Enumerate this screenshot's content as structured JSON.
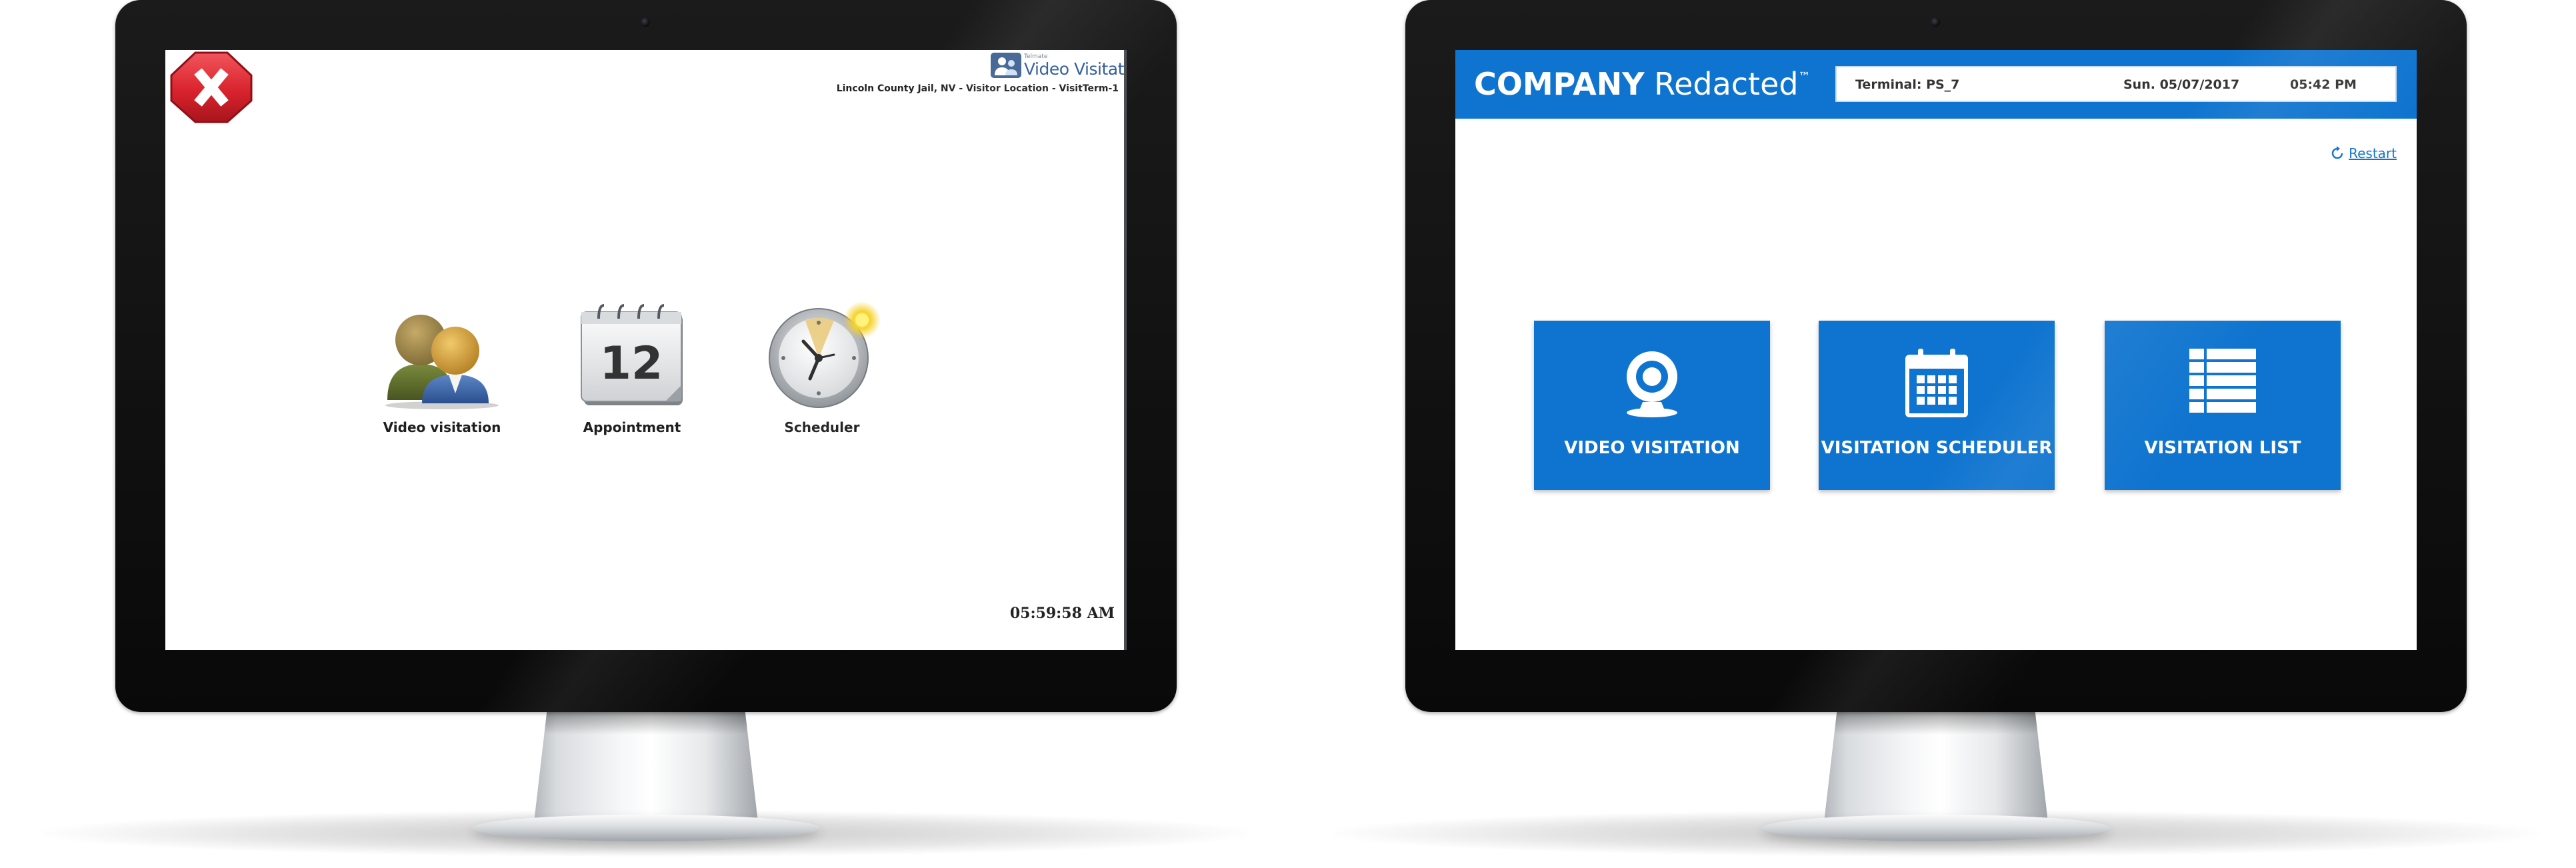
{
  "left_screen": {
    "brand": {
      "small_text": "Telmate",
      "main_text": "Video Visitation"
    },
    "location": "Lincoln County Jail, NV - Visitor Location - VisitTerm-1",
    "launchers": [
      {
        "label": "Video visitation",
        "icon": "users-icon"
      },
      {
        "label": "Appointment",
        "icon": "calendar-icon",
        "calendar_day": "12"
      },
      {
        "label": "Scheduler",
        "icon": "clock-icon"
      }
    ],
    "clock": "05:59:58 AM",
    "close_icon": "close-icon",
    "colors": {
      "close": "#d9232d",
      "brand": "#2d5a9c"
    }
  },
  "right_screen": {
    "company": {
      "bold": "COMPANY",
      "rest": "Redacted",
      "trademark": "™"
    },
    "terminal": "Terminal: PS_7",
    "date": "Sun. 05/07/2017",
    "time": "05:42 PM",
    "restart": "Restart",
    "tiles": [
      {
        "label": "VIDEO VISITATION",
        "icon": "webcam-icon"
      },
      {
        "label": "VISITATION SCHEDULER",
        "icon": "calendar-icon"
      },
      {
        "label": "VISITATION LIST",
        "icon": "list-icon"
      }
    ],
    "colors": {
      "accent": "#0f74cf"
    }
  }
}
